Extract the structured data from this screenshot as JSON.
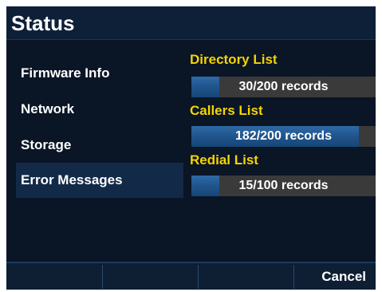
{
  "header": {
    "title": "Status"
  },
  "sidebar": {
    "items": [
      {
        "label": "Firmware Info"
      },
      {
        "label": "Network"
      },
      {
        "label": "Storage"
      },
      {
        "label": "Error Messages",
        "selected": true
      }
    ]
  },
  "lists": [
    {
      "title": "Directory List",
      "records_label": "30/200 records",
      "used": 30,
      "capacity": 200
    },
    {
      "title": "Callers List",
      "records_label": "182/200 records",
      "used": 182,
      "capacity": 200
    },
    {
      "title": "Redial List",
      "records_label": "15/100 records",
      "used": 15,
      "capacity": 100
    }
  ],
  "softkeys": [
    {
      "label": ""
    },
    {
      "label": ""
    },
    {
      "label": ""
    },
    {
      "label": "Cancel"
    }
  ],
  "colors": {
    "background": "#0a1526",
    "accent_title": "#f4d400",
    "bar_fill": "#1f548c",
    "bar_track": "#3a3a3a",
    "selected_item": "#122a48"
  }
}
